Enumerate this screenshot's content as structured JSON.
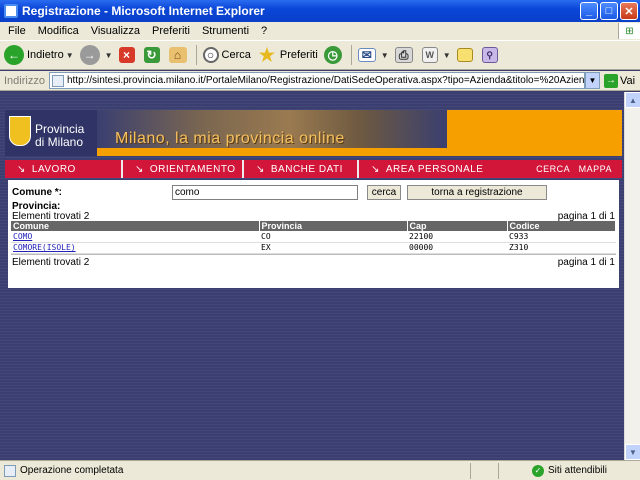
{
  "window": {
    "title": "Registrazione - Microsoft Internet Explorer",
    "minimize": "_",
    "maximize": "□",
    "close": "✕"
  },
  "menu": [
    "File",
    "Modifica",
    "Visualizza",
    "Preferiti",
    "Strumenti",
    "?"
  ],
  "toolbar": {
    "back_label": "Indietro",
    "search_label": "Cerca",
    "favorites_label": "Preferiti"
  },
  "address": {
    "label": "Indirizzo",
    "url": "http://sintesi.provincia.milano.it/PortaleMilano/Registrazione/DatiSedeOperativa.aspx?tipo=Azienda&titolo=%20Azienda",
    "go_label": "Vai"
  },
  "banner": {
    "provincia_line1": "Provincia",
    "provincia_line2": "di Milano",
    "slogan": "Milano, la mia provincia online"
  },
  "nav": {
    "items": [
      "LAVORO",
      "ORIENTAMENTO",
      "BANCHE DATI",
      "AREA PERSONALE"
    ],
    "cerca": "CERCA",
    "mappa": "MAPPA"
  },
  "form": {
    "comune_label": "Comune *:",
    "comune_value": "como",
    "cerca_button": "cerca",
    "torna_button": "torna a registrazione",
    "provincia_label": "Provincia:"
  },
  "results": {
    "found_text": "Elementi trovati 2",
    "page_text": "pagina 1 di 1",
    "columns": [
      "Comune",
      "Provincia",
      "Cap",
      "Codice"
    ],
    "rows": [
      {
        "comune": "COMO",
        "provincia": "CO",
        "cap": "22100",
        "codice": "C933"
      },
      {
        "comune": "COMORE(ISOLE)",
        "provincia": "EX",
        "cap": "00000",
        "codice": "Z310"
      }
    ]
  },
  "status": {
    "left_text": "Operazione completata",
    "right_text": "Siti attendibili"
  },
  "colors": {
    "nav_red": "#d2163a",
    "banner_orange": "#f5a000",
    "page_bg": "#3b3e70"
  }
}
